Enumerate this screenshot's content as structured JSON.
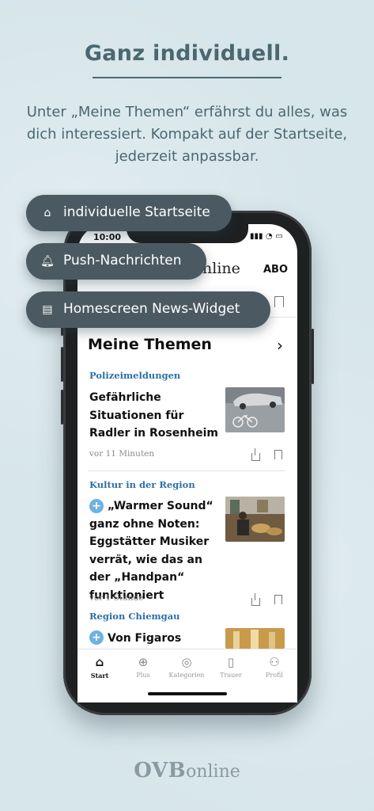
{
  "headline": "Ganz individuell.",
  "subline": "Unter „Meine Themen“ erfährst du alles, was dich interessiert. Kompakt auf der Startseite, jederzeit anpassbar.",
  "pills": [
    {
      "label": "individuelle Startseite",
      "icon": "home-icon"
    },
    {
      "label": "Push-Nachrichten",
      "icon": "bell-icon"
    },
    {
      "label": "Homescreen News-Widget",
      "icon": "widget-icon"
    }
  ],
  "status": {
    "time": "10:00"
  },
  "app_header": {
    "logo_text": "nline",
    "abo": "ABO"
  },
  "section": {
    "title": "Meine Themen"
  },
  "articles": [
    {
      "category": "Polizeimeldungen",
      "title": "Gefährliche Situationen für Radler in Rosenheim",
      "time": "vor 11 Minuten",
      "plus": false
    },
    {
      "category": "Kultur in der Region",
      "title": "„Warmer Sound“ ganz ohne Noten: Eggstätter Musiker verrät, wie das an der „Handpan“ funktioniert",
      "time": "vor 1 Stunde",
      "plus": true
    },
    {
      "category": "Region Chiemgau",
      "title": "Von Figaros",
      "plus": true
    }
  ],
  "tabs": [
    {
      "label": "Start",
      "icon": "home-icon",
      "active": true
    },
    {
      "label": "Plus",
      "icon": "plus-circle-icon"
    },
    {
      "label": "Kategorien",
      "icon": "compass-icon"
    },
    {
      "label": "Trauer",
      "icon": "candle-icon"
    },
    {
      "label": "Profil",
      "icon": "person-icon"
    }
  ],
  "footer": {
    "brand": "OVB",
    "brand_suffix": "online"
  },
  "colors": {
    "background": "#d7e6ea",
    "pill": "#4b5a62",
    "accent_blue": "#2d6fa8",
    "plus_badge": "#6cb2e4",
    "text_dark": "#4b6770"
  }
}
